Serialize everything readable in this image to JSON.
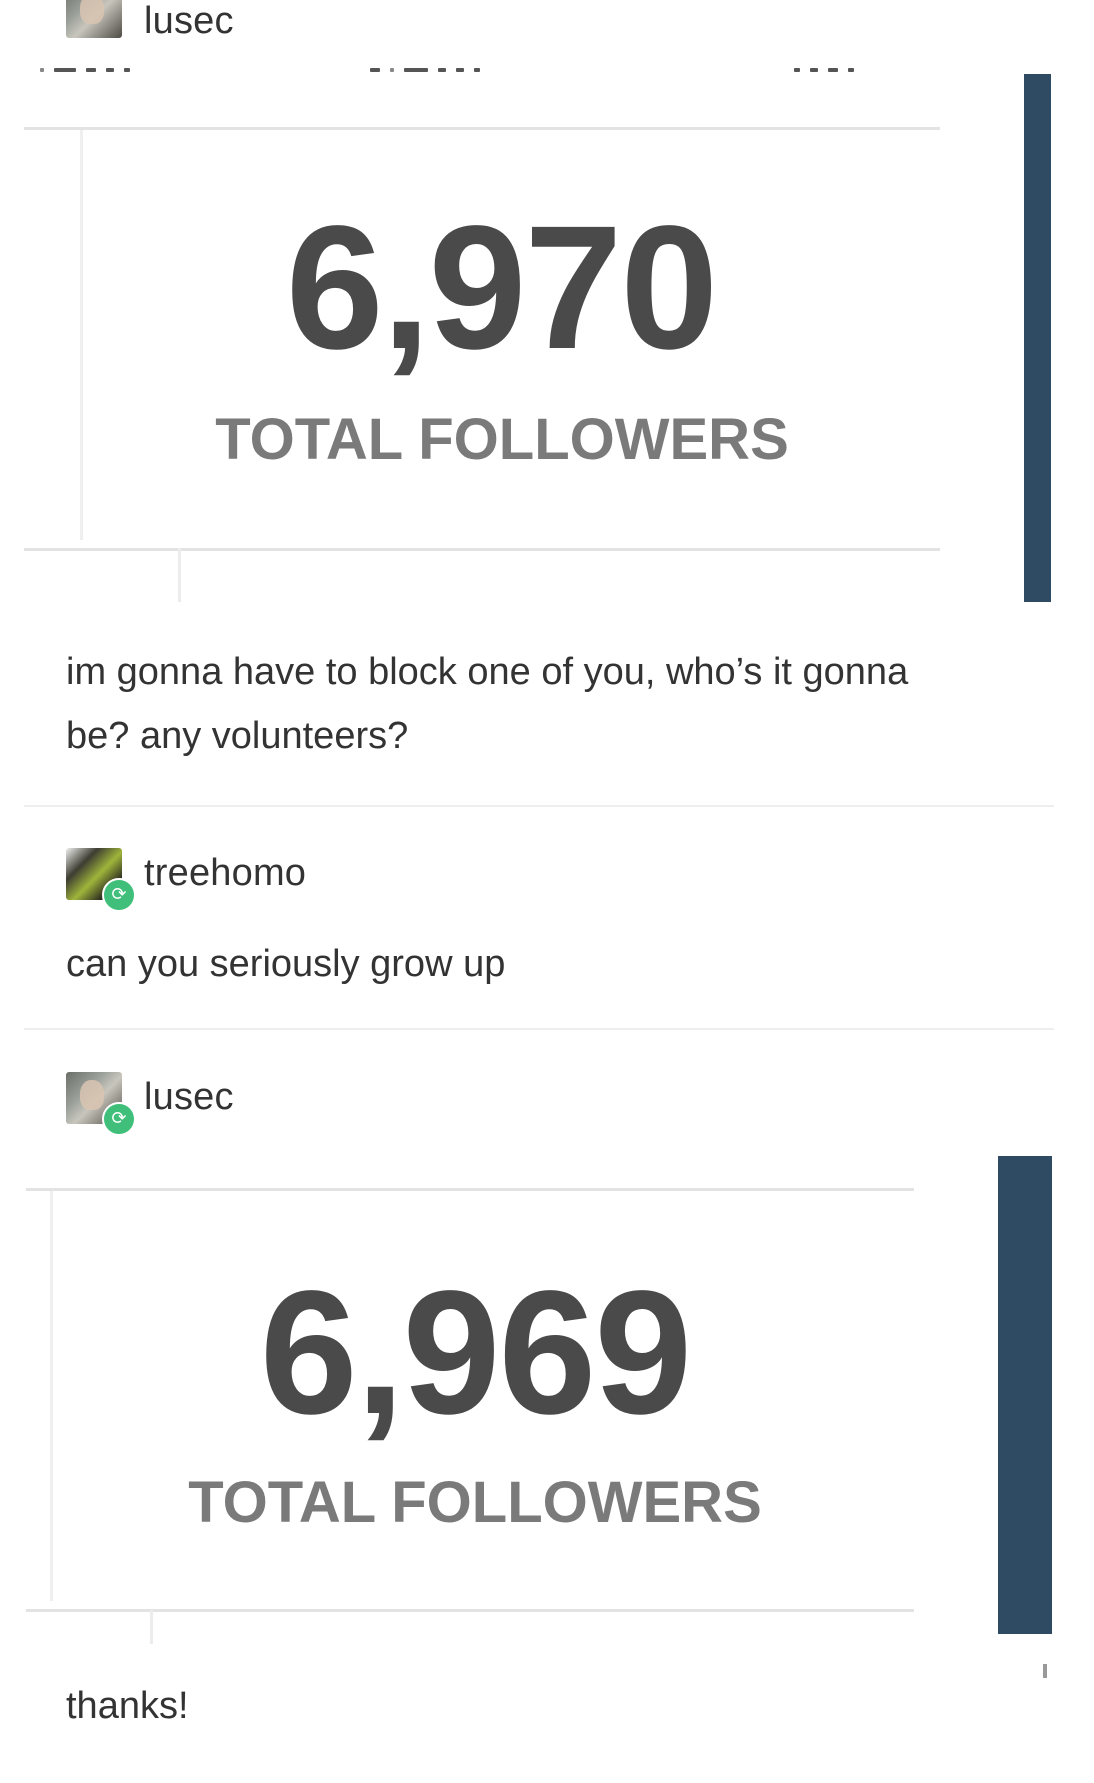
{
  "posts": [
    {
      "username": "lusec",
      "avatar_icon": "user-avatar-icon",
      "reblogged": false,
      "stat": {
        "number": "6,970",
        "label": "TOTAL FOLLOWERS"
      },
      "text": "im gonna have to block one of you, who’s it gonna be? any volunteers?"
    },
    {
      "username": "treehomo",
      "avatar_icon": "user-avatar-icon",
      "reblogged": true,
      "text": "can you seriously grow up"
    },
    {
      "username": "lusec",
      "avatar_icon": "user-avatar-icon",
      "reblogged": true,
      "stat": {
        "number": "6,969",
        "label": "TOTAL FOLLOWERS"
      },
      "text": "thanks!"
    }
  ],
  "colors": {
    "side_bar": "#2f4a63",
    "reblog_badge": "#3fbf7a",
    "stat_number": "#4a4a4a",
    "stat_label": "#7a7a7a"
  },
  "icons": {
    "reblog": "reblog-icon"
  }
}
